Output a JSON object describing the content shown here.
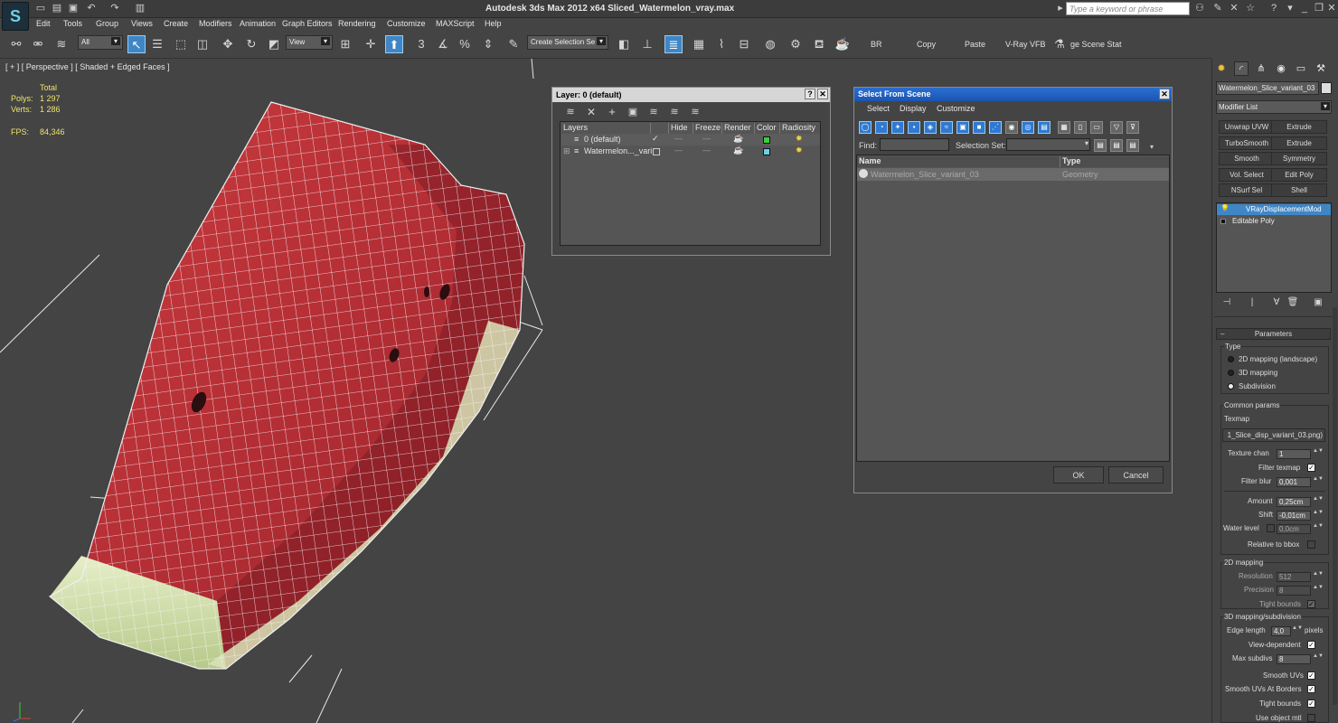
{
  "app": {
    "title": "Autodesk 3ds Max  2012 x64    Sliced_Watermelon_vray.max",
    "search_placeholder": "Type a keyword or phrase"
  },
  "menus": [
    "Edit",
    "Tools",
    "Group",
    "Views",
    "Create",
    "Modifiers",
    "Animation",
    "Graph Editors",
    "Rendering",
    "Customize",
    "MAXScript",
    "Help"
  ],
  "toolbar": {
    "filter": "All",
    "refcoord": "View",
    "snap_num": "3",
    "selection_set": "Create Selection Se",
    "labels": {
      "br": "BR",
      "copy": "Copy",
      "paste": "Paste",
      "vray": "V-Ray VFB",
      "stat": "ge Scene Stat"
    }
  },
  "viewport": {
    "label": "[ + ] [ Perspective ] [ Shaded + Edged Faces ]",
    "stats": {
      "total": "Total",
      "polys_label": "Polys:",
      "polys": "1 297",
      "verts_label": "Verts:",
      "verts": "1 286",
      "fps_label": "FPS:",
      "fps": "84,346"
    }
  },
  "layer_dialog": {
    "title": "Layer: 0 (default)",
    "columns": [
      "Layers",
      "Hide",
      "Freeze",
      "Render",
      "Color",
      "Radiosity"
    ],
    "rows": [
      {
        "name": "0 (default)",
        "color": "#3ad03a"
      },
      {
        "name": "Watermelon..._vari",
        "color": "#6ad0e8"
      }
    ]
  },
  "select_dialog": {
    "title": "Select From Scene",
    "menu": [
      "Select",
      "Display",
      "Customize"
    ],
    "find_label": "Find:",
    "selection_set_label": "Selection Set:",
    "columns": [
      "Name",
      "Type"
    ],
    "rows": [
      {
        "name": "Watermelon_Slice_variant_03",
        "type": "Geometry"
      }
    ],
    "ok": "OK",
    "cancel": "Cancel"
  },
  "command_panel": {
    "object_name": "Watermelon_Slice_variant_03",
    "modifier_list": "Modifier List",
    "buttons": [
      "Unwrap UVW",
      "Extrude",
      "TurboSmooth",
      "Extrude",
      "Smooth",
      "Symmetry",
      "Vol. Select",
      "Edit Poly",
      "NSurf Sel",
      "Shell"
    ],
    "stack": [
      "VRayDisplacementMod",
      "Editable Poly"
    ],
    "rollout": "Parameters",
    "type_label": "Type",
    "types": [
      "2D mapping (landscape)",
      "3D mapping",
      "Subdivision"
    ],
    "common": "Common params",
    "texmap_label": "Texmap",
    "texmap_value": "1_Slice_disp_variant_03.png)",
    "texture_chan_label": "Texture chan",
    "texture_chan": "1",
    "filter_texmap": "Filter texmap",
    "filter_blur_label": "Filter blur",
    "filter_blur": "0,001",
    "amount_label": "Amount",
    "amount": "0,25cm",
    "shift_label": "Shift",
    "shift": "-0,01cm",
    "water_label": "Water level",
    "water": "0,0cm",
    "rel_bbox": "Relative to bbox",
    "map2d": "2D mapping",
    "resolution_label": "Resolution",
    "resolution": "512",
    "precision_label": "Precision",
    "precision": "8",
    "tight_bounds": "Tight bounds",
    "map3d": "3D mapping/subdivision",
    "edge_label": "Edge length",
    "edge": "4,0",
    "pixels": "pixels",
    "view_dep": "View-dependent",
    "max_subdivs_label": "Max subdivs",
    "max_subdivs": "8",
    "smooth_uvs": "Smooth UVs",
    "smooth_uvs_borders": "Smooth UVs At Borders",
    "tight_bounds2": "Tight bounds",
    "use_obj_mtl": "Use object mtl"
  }
}
